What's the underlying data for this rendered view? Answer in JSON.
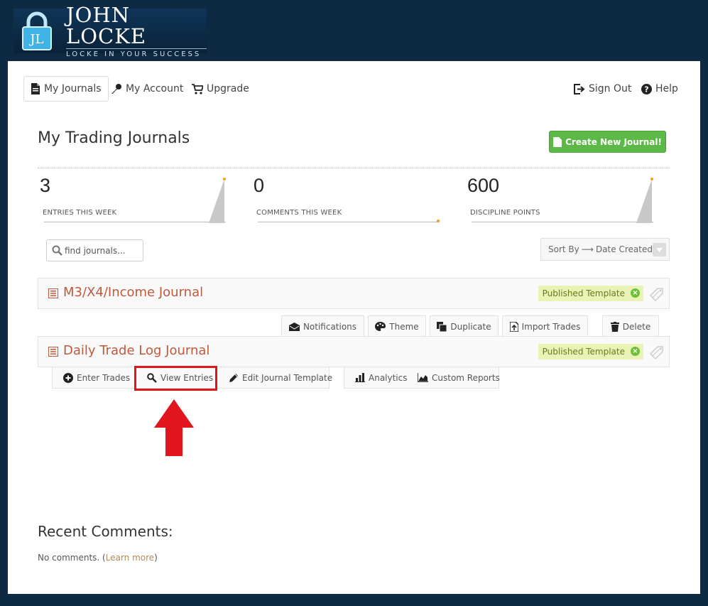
{
  "brand": {
    "name": "JOHN LOCKE",
    "tagline": "LOCKE IN YOUR SUCCESS",
    "monogram": "JL"
  },
  "nav": {
    "left": [
      {
        "label": "My Journals",
        "icon": "document-icon",
        "active": true
      },
      {
        "label": "My Account",
        "icon": "key-icon"
      },
      {
        "label": "Upgrade",
        "icon": "cart-icon"
      }
    ],
    "right": [
      {
        "label": "Sign Out",
        "icon": "sign-out-icon"
      },
      {
        "label": "Help",
        "icon": "help-icon"
      }
    ]
  },
  "page": {
    "title": "My Trading Journals",
    "create_label": "Create New Journal!"
  },
  "stats": [
    {
      "value": "3",
      "label": "ENTRIES THIS WEEK"
    },
    {
      "value": "0",
      "label": "COMMENTS THIS WEEK"
    },
    {
      "value": "600",
      "label": "DISCIPLINE POINTS"
    }
  ],
  "search": {
    "placeholder": "find journals..."
  },
  "sort": {
    "label": "Sort By",
    "arrow": "⟶",
    "value": "Date Created"
  },
  "journals": [
    {
      "title": "M3/X4/Income Journal",
      "badge": "Published Template",
      "actions": [
        "Notifications",
        "Theme",
        "Duplicate",
        "Import Trades",
        "Delete"
      ]
    },
    {
      "title": "Daily Trade Log Journal",
      "badge": "Published Template",
      "actions": [
        "Enter Trades",
        "View Entries",
        "Edit Journal Template",
        "Analytics",
        "Custom Reports"
      ]
    }
  ],
  "recent": {
    "title": "Recent Comments:",
    "text_before": "No comments. (",
    "link": "Learn more",
    "text_after": ")"
  },
  "colors": {
    "background": "#0e2a42",
    "accent_green": "#5cb847",
    "journal_title": "#c0583c",
    "highlight_red": "#e0151d"
  }
}
